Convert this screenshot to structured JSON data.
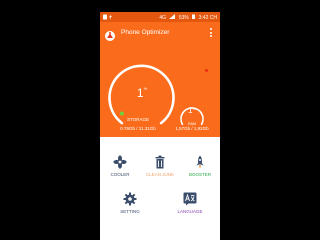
{
  "status_bar": {
    "signal": "4G",
    "battery": "53%",
    "time": "3:42 CH"
  },
  "app": {
    "title": "Phone Optimizer",
    "logo_icon": "broom-logo-icon",
    "menu_icon": "overflow-menu-icon"
  },
  "storage": {
    "percent": "1",
    "percent_value": 1,
    "unit": "%",
    "label": "STORAGE",
    "detail": "0.76Gb / 11.31Gb"
  },
  "ram": {
    "percent": "1",
    "percent_value": 1,
    "unit": "%",
    "label": "RAM",
    "detail": "1,57Gb / 1,92Gb"
  },
  "features": [
    {
      "label": "COOLER",
      "icon": "fan-icon",
      "color": "#3a4d6b"
    },
    {
      "label": "CLEAN JUNK",
      "icon": "trash-icon",
      "color": "#f3a06a"
    },
    {
      "label": "BOOSTER",
      "icon": "rocket-icon",
      "color": "#27a84a"
    },
    {
      "label": "SETTING",
      "icon": "gear-icon",
      "color": "#3a4d6b"
    },
    {
      "label": "LANGUAGE",
      "icon": "language-icon",
      "color": "#8a3fb5"
    }
  ],
  "colors": {
    "accent": "#fa6c1c",
    "status_bar": "#e4570f",
    "gauge_marker": "#6bd23c",
    "alert": "#e8300d"
  }
}
